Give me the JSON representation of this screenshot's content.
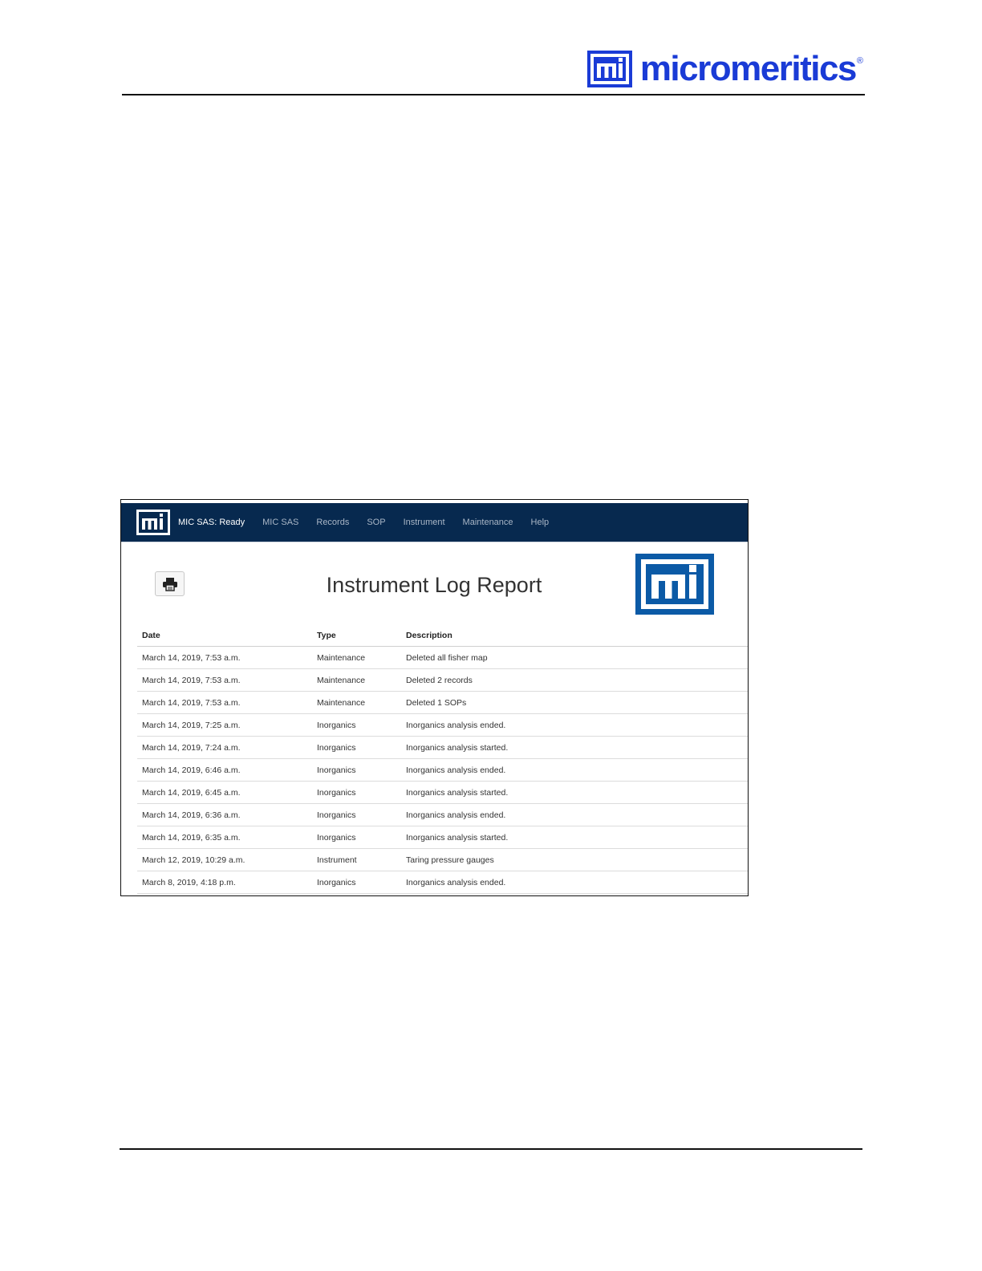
{
  "brand": {
    "wordmark": "micromeritics",
    "registered": "®"
  },
  "app": {
    "status": "MIC SAS: Ready",
    "nav": [
      "MIC SAS",
      "Records",
      "SOP",
      "Instrument",
      "Maintenance",
      "Help"
    ],
    "nav_color": "#07294f"
  },
  "report": {
    "title": "Instrument Log Report",
    "columns": [
      "Date",
      "Type",
      "Description"
    ],
    "rows": [
      [
        "March 14, 2019, 7:53 a.m.",
        "Maintenance",
        "Deleted all fisher map"
      ],
      [
        "March 14, 2019, 7:53 a.m.",
        "Maintenance",
        "Deleted 2 records"
      ],
      [
        "March 14, 2019, 7:53 a.m.",
        "Maintenance",
        "Deleted 1 SOPs"
      ],
      [
        "March 14, 2019, 7:25 a.m.",
        "Inorganics",
        "Inorganics analysis ended."
      ],
      [
        "March 14, 2019, 7:24 a.m.",
        "Inorganics",
        "Inorganics analysis started."
      ],
      [
        "March 14, 2019, 6:46 a.m.",
        "Inorganics",
        "Inorganics analysis ended."
      ],
      [
        "March 14, 2019, 6:45 a.m.",
        "Inorganics",
        "Inorganics analysis started."
      ],
      [
        "March 14, 2019, 6:36 a.m.",
        "Inorganics",
        "Inorganics analysis ended."
      ],
      [
        "March 14, 2019, 6:35 a.m.",
        "Inorganics",
        "Inorganics analysis started."
      ],
      [
        "March 12, 2019, 10:29 a.m.",
        "Instrument",
        "Taring pressure gauges"
      ],
      [
        "March 8, 2019, 4:18 p.m.",
        "Inorganics",
        "Inorganics analysis ended."
      ]
    ]
  },
  "icons": {
    "print": "printer-icon",
    "logo": "mi-logo-icon"
  },
  "colors": {
    "brand_blue": "#1a3bd6",
    "report_logo_blue": "#0b5aa6"
  }
}
